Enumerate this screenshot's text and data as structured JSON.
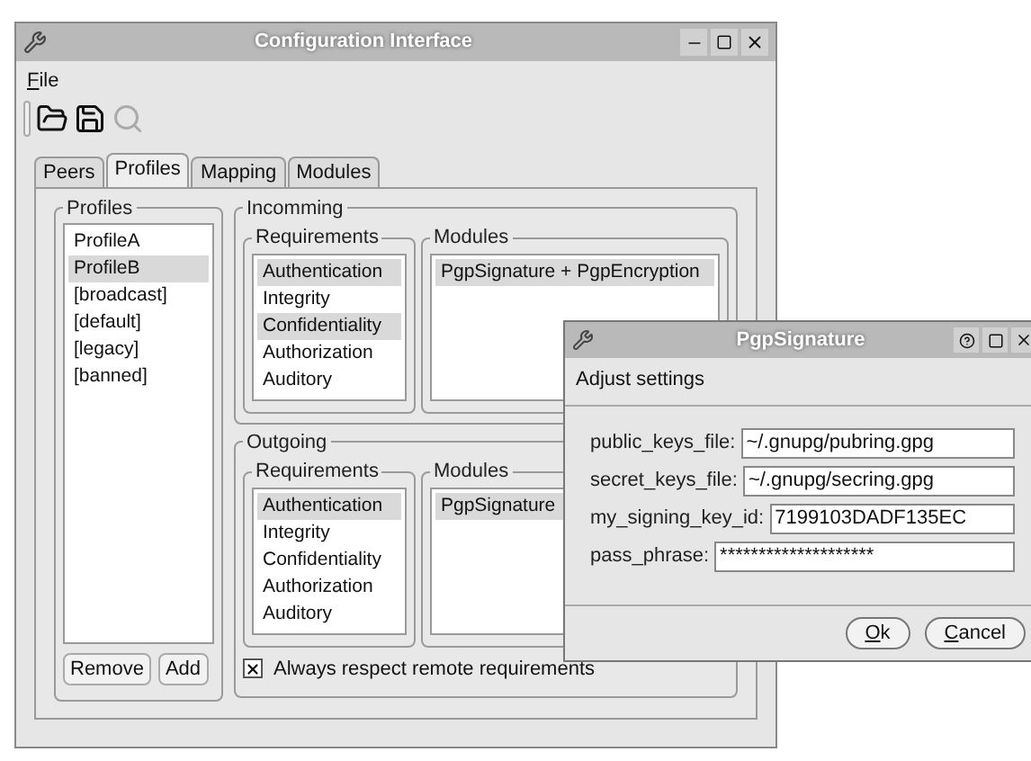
{
  "main_window": {
    "title": "Configuration Interface",
    "menu": [
      "File"
    ],
    "toolbar": [
      {
        "kind": "open",
        "disabled": false
      },
      {
        "kind": "save",
        "disabled": false
      },
      {
        "kind": "search",
        "disabled": true
      }
    ],
    "tabs": [
      {
        "label": "Peers",
        "selected": false
      },
      {
        "label": "Profiles",
        "selected": true
      },
      {
        "label": "Mapping",
        "selected": false
      },
      {
        "label": "Modules",
        "selected": false
      }
    ],
    "profiles": {
      "title": "Profiles",
      "items": [
        {
          "label": "ProfileA",
          "selected": false
        },
        {
          "label": "ProfileB",
          "selected": true
        },
        {
          "label": "[broadcast]",
          "selected": false
        },
        {
          "label": "[default]",
          "selected": false
        },
        {
          "label": "[legacy]",
          "selected": false
        },
        {
          "label": "[banned]",
          "selected": false
        }
      ],
      "buttons": [
        "Remove",
        "Add"
      ]
    },
    "incoming": {
      "title": "Incomming",
      "requirements": {
        "title": "Requirements",
        "items": [
          {
            "label": "Authentication",
            "selected": true
          },
          {
            "label": "Integrity",
            "selected": false
          },
          {
            "label": "Confidentiality",
            "selected": true
          },
          {
            "label": "Authorization",
            "selected": false
          },
          {
            "label": "Auditory",
            "selected": false
          }
        ]
      },
      "modules": {
        "title": "Modules",
        "items": [
          {
            "label": "PgpSignature + PgpEncryption",
            "selected": true
          }
        ]
      }
    },
    "outgoing": {
      "title": "Outgoing",
      "requirements": {
        "title": "Requirements",
        "items": [
          {
            "label": "Authentication",
            "selected": true
          },
          {
            "label": "Integrity",
            "selected": false
          },
          {
            "label": "Confidentiality",
            "selected": false
          },
          {
            "label": "Authorization",
            "selected": false
          },
          {
            "label": "Auditory",
            "selected": false
          }
        ]
      },
      "modules": {
        "title": "Modules",
        "items": [
          {
            "label": "PgpSignature",
            "selected": true
          }
        ]
      }
    },
    "remote_checkbox": {
      "label": "Always respect remote requirements",
      "checked": true
    }
  },
  "dialog": {
    "title": "PgpSignature",
    "heading": "Adjust settings",
    "fields": [
      {
        "label": "public_keys_file:",
        "value": "~/.gnupg/pubring.gpg"
      },
      {
        "label": "secret_keys_file:",
        "value": "~/.gnupg/secring.gpg"
      },
      {
        "label": "my_signing_key_id:",
        "value": "7199103DADF135EC"
      },
      {
        "label": "pass_phrase:",
        "value": "********************"
      }
    ],
    "buttons": [
      "Ok",
      "Cancel"
    ]
  }
}
